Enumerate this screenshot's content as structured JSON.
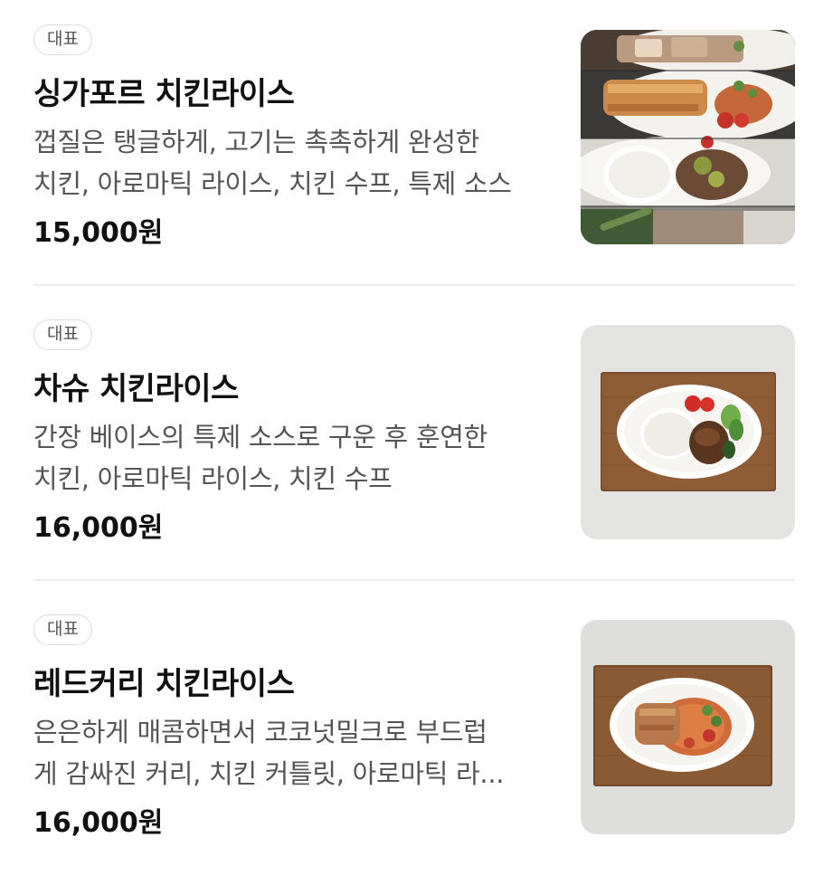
{
  "menu": {
    "items": [
      {
        "badge": "대표",
        "name": "싱가포르 치킨라이스",
        "description_lines": [
          "껍질은 탱글하게, 고기는 촉촉하게 완성한",
          "치킨, 아로마틱 라이스, 치킨 수프, 특제 소스"
        ],
        "price": "15,000원",
        "image": "singapore-chicken-rice-photo"
      },
      {
        "badge": "대표",
        "name": "차슈 치킨라이스",
        "description_lines": [
          "간장 베이스의 특제 소스로 구운 후 훈연한",
          "치킨, 아로마틱 라이스, 치킨 수프"
        ],
        "price": "16,000원",
        "image": "chashu-chicken-rice-photo"
      },
      {
        "badge": "대표",
        "name": "레드커리 치킨라이스",
        "description_lines": [
          "은은하게 매콤하면서 코코넛밀크로 부드럽",
          "게 감싸진 커리, 치킨 커틀릿, 아로마틱 라..."
        ],
        "price": "16,000원",
        "image": "red-curry-chicken-rice-photo"
      }
    ]
  },
  "colors": {
    "badge_border": "#dcdcdc",
    "text_primary": "#111111",
    "text_secondary": "#555555",
    "divider": "#eeeeee"
  }
}
